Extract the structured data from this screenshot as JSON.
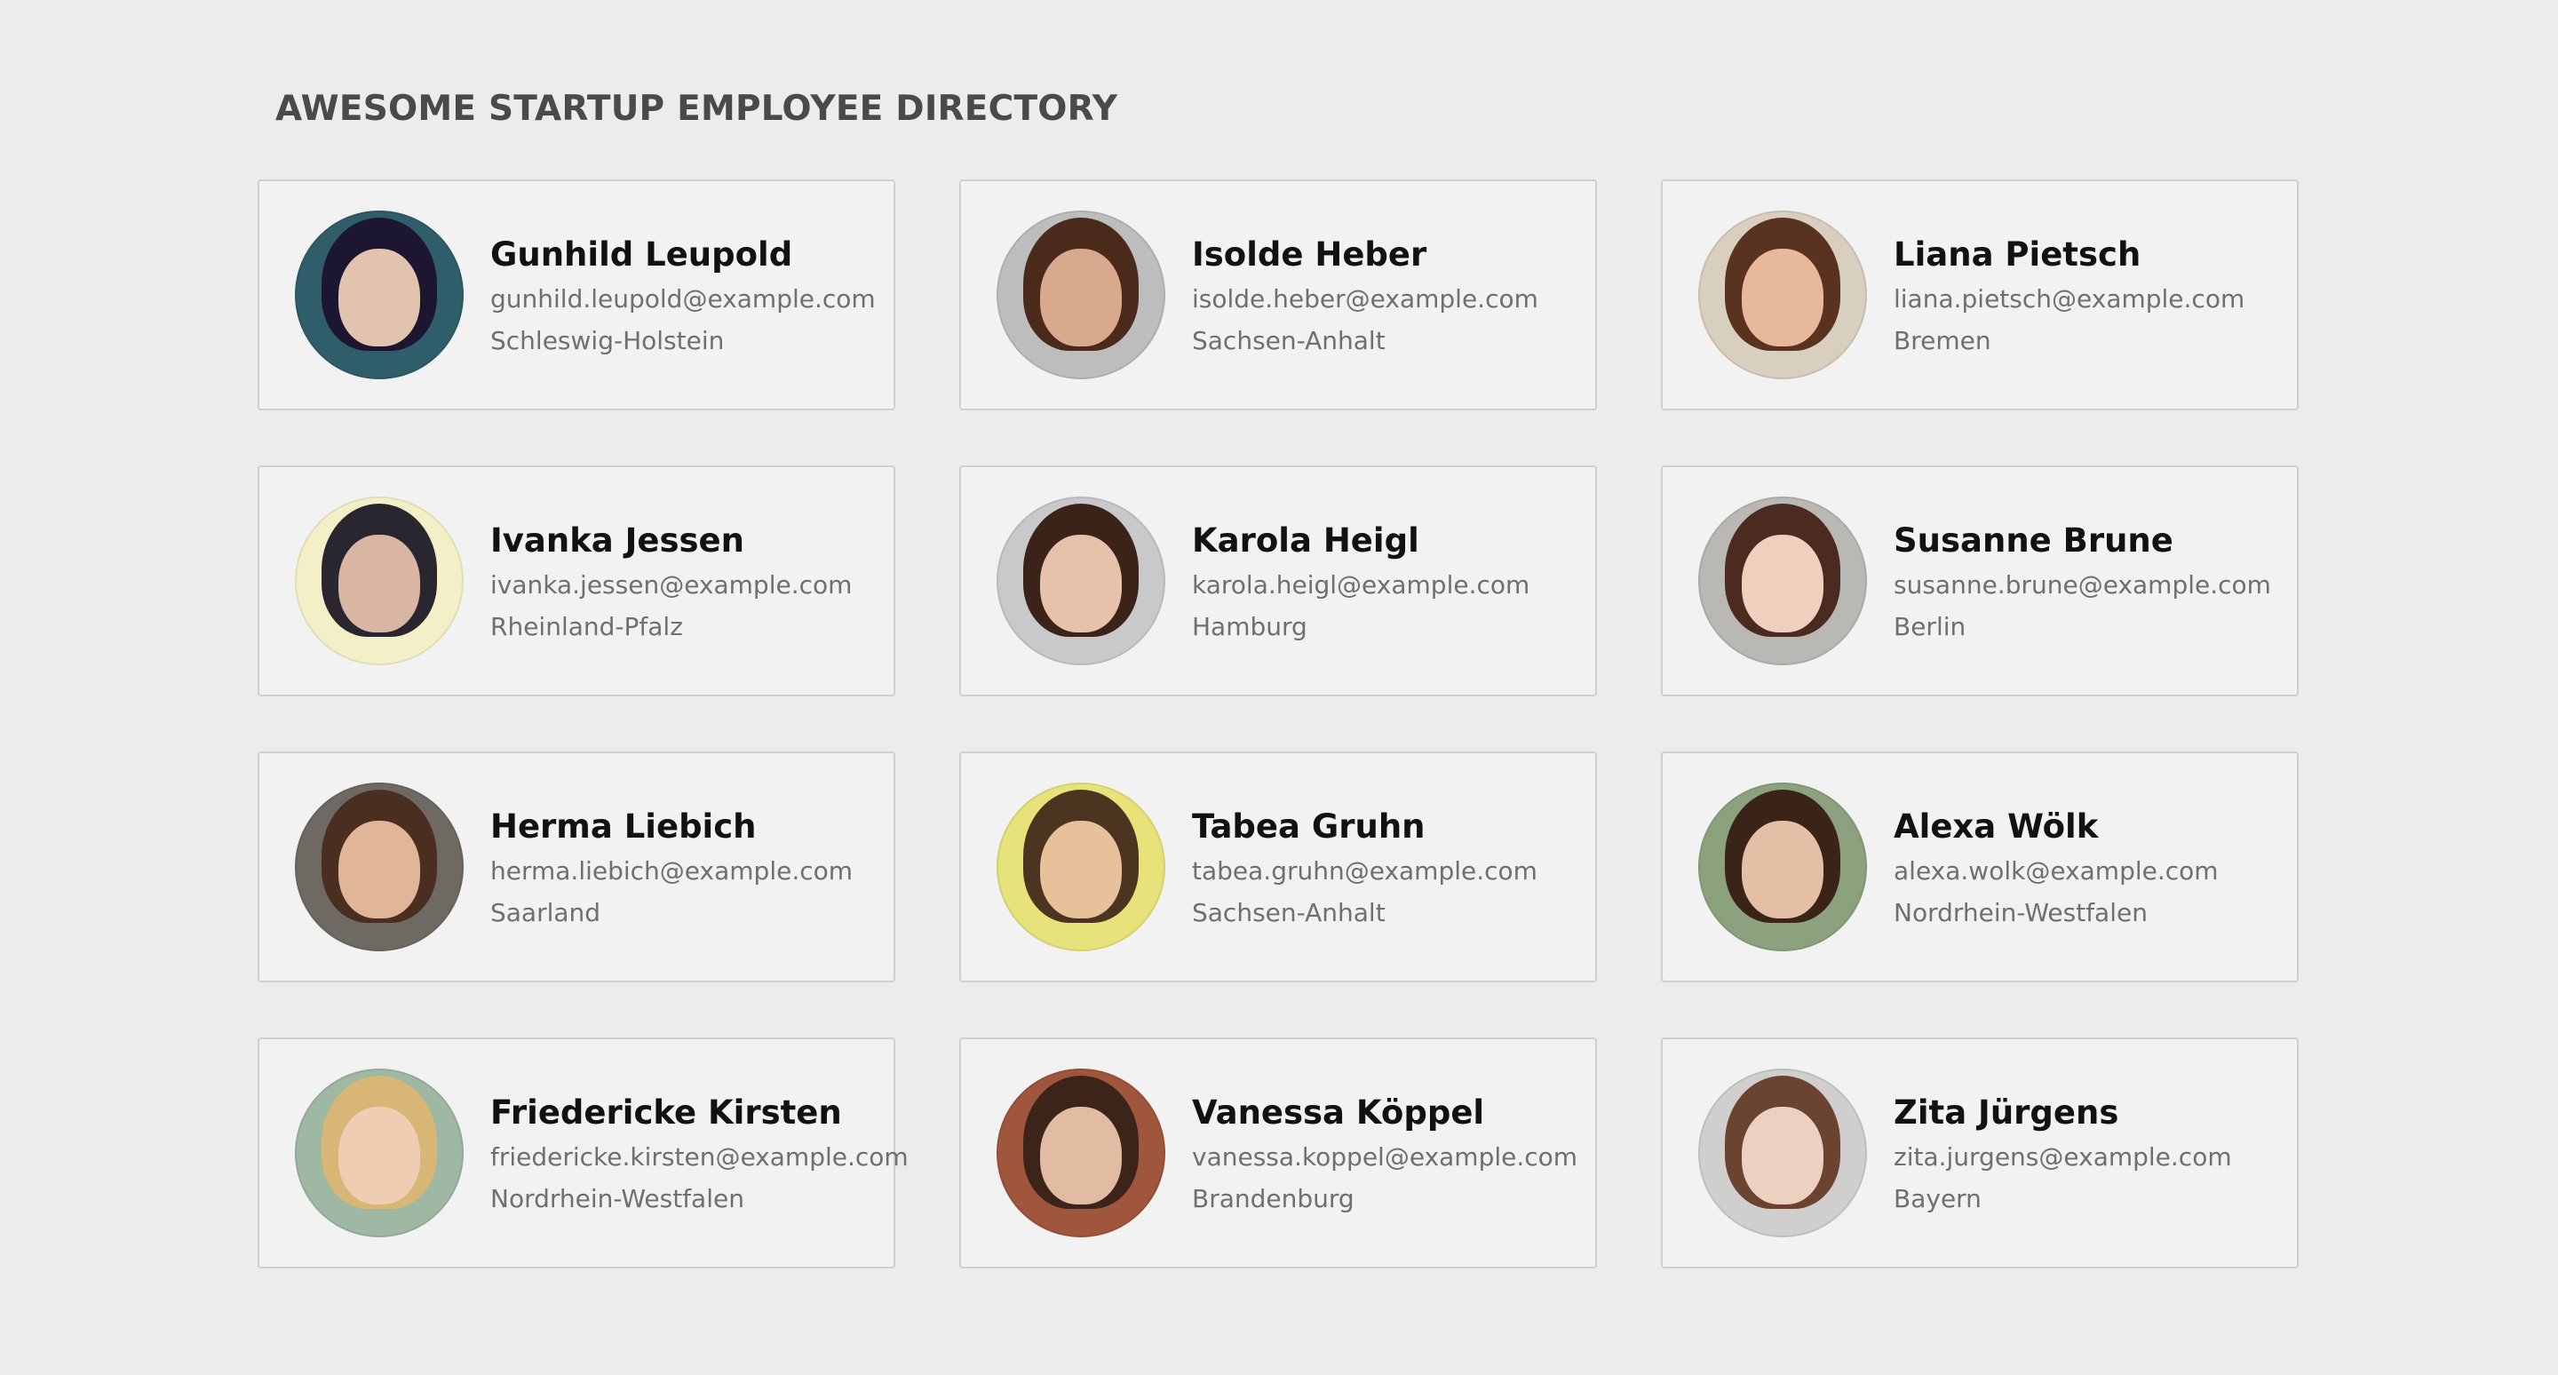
{
  "header": {
    "title": "AWESOME STARTUP EMPLOYEE DIRECTORY"
  },
  "employees": [
    {
      "name": "Gunhild Leupold",
      "email": "gunhild.leupold@example.com",
      "region": "Schleswig-Holstein",
      "bg": "#2f5d6a",
      "hair": "#1c1630",
      "skin": "#e2c3ad"
    },
    {
      "name": "Isolde Heber",
      "email": "isolde.heber@example.com",
      "region": "Sachsen-Anhalt",
      "bg": "#bdbdbd",
      "hair": "#4a2a1a",
      "skin": "#d9a98d"
    },
    {
      "name": "Liana Pietsch",
      "email": "liana.pietsch@example.com",
      "region": "Bremen",
      "bg": "#d9cfbf",
      "hair": "#5a3320",
      "skin": "#e8b89c"
    },
    {
      "name": "Ivanka Jessen",
      "email": "ivanka.jessen@example.com",
      "region": "Rheinland-Pfalz",
      "bg": "#f3f0c8",
      "hair": "#2a2630",
      "skin": "#d9b6a4"
    },
    {
      "name": "Karola Heigl",
      "email": "karola.heigl@example.com",
      "region": "Hamburg",
      "bg": "#c9c9cb",
      "hair": "#3b231a",
      "skin": "#e6c2ab"
    },
    {
      "name": "Susanne Brune",
      "email": "susanne.brune@example.com",
      "region": "Berlin",
      "bg": "#b9b8b5",
      "hair": "#4b2a20",
      "skin": "#efcfbe"
    },
    {
      "name": "Herma Liebich",
      "email": "herma.liebich@example.com",
      "region": "Saarland",
      "bg": "#6e6a63",
      "hair": "#4a2f20",
      "skin": "#e1b597"
    },
    {
      "name": "Tabea Gruhn",
      "email": "tabea.gruhn@example.com",
      "region": "Sachsen-Anhalt",
      "bg": "#e8e27a",
      "hair": "#4b3520",
      "skin": "#e7c19a"
    },
    {
      "name": "Alexa Wölk",
      "email": "alexa.wolk@example.com",
      "region": "Nordrhein-Westfalen",
      "bg": "#8ca27e",
      "hair": "#3a2418",
      "skin": "#e4bfa6"
    },
    {
      "name": "Friedericke Kirsten",
      "email": "friedericke.kirsten@example.com",
      "region": "Nordrhein-Westfalen",
      "bg": "#9fb8a4",
      "hair": "#d7b676",
      "skin": "#efcdb3"
    },
    {
      "name": "Vanessa Köppel",
      "email": "vanessa.koppel@example.com",
      "region": "Brandenburg",
      "bg": "#a0553d",
      "hair": "#3c241a",
      "skin": "#e2bba3"
    },
    {
      "name": "Zita Jürgens",
      "email": "zita.jurgens@example.com",
      "region": "Bayern",
      "bg": "#d1cfcd",
      "hair": "#6a4430",
      "skin": "#ecd0c0"
    }
  ]
}
